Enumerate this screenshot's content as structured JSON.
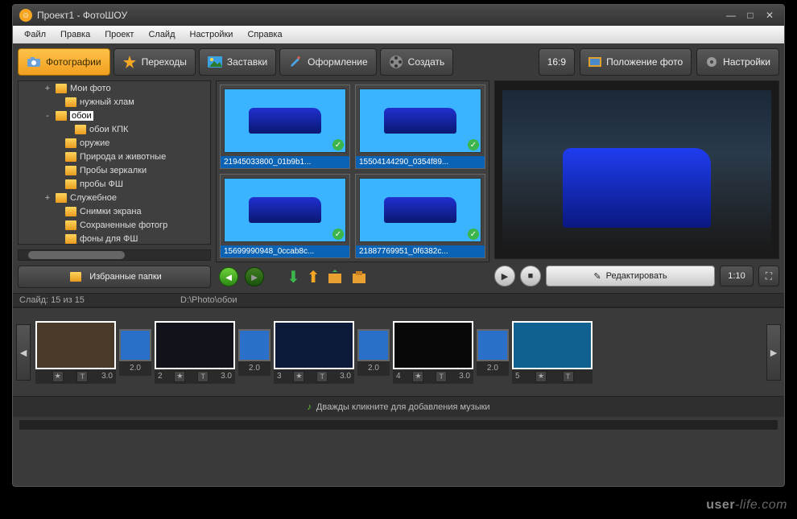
{
  "app": {
    "title": "Проект1 - ФотоШОУ"
  },
  "menu": [
    "Файл",
    "Правка",
    "Проект",
    "Слайд",
    "Настройки",
    "Справка"
  ],
  "tabs": [
    {
      "label": "Фотографии",
      "active": true
    },
    {
      "label": "Переходы"
    },
    {
      "label": "Заставки"
    },
    {
      "label": "Оформление"
    },
    {
      "label": "Создать"
    }
  ],
  "aspect_label": "16:9",
  "right_buttons": [
    {
      "label": "Положение фото"
    },
    {
      "label": "Настройки"
    }
  ],
  "tree": [
    {
      "pm": "+",
      "label": "Мои фото",
      "indent": 2
    },
    {
      "pm": "",
      "label": "нужный хлам",
      "indent": 3
    },
    {
      "pm": "-",
      "label": "обои",
      "indent": 2,
      "selected": true
    },
    {
      "pm": "",
      "label": "обои КПК",
      "indent": 4
    },
    {
      "pm": "",
      "label": "оружие",
      "indent": 3
    },
    {
      "pm": "",
      "label": "Природа и животные",
      "indent": 3
    },
    {
      "pm": "",
      "label": "Пробы зеркалки",
      "indent": 3
    },
    {
      "pm": "",
      "label": "пробы ФШ",
      "indent": 3
    },
    {
      "pm": "+",
      "label": "Служебное",
      "indent": 2
    },
    {
      "pm": "",
      "label": "Снимки экрана",
      "indent": 3
    },
    {
      "pm": "",
      "label": "Сохраненные фотогр",
      "indent": 3
    },
    {
      "pm": "",
      "label": "фоны для ФШ",
      "indent": 3
    }
  ],
  "fav_btn": "Избранные папки",
  "thumbs": [
    {
      "name": "21945033800_01b9b1..."
    },
    {
      "name": "15504144290_0354f89..."
    },
    {
      "name": "15699990948_0ccab8c..."
    },
    {
      "name": "21887769951_0f6382c..."
    }
  ],
  "edit_btn": "Редактировать",
  "time_label": "1:10",
  "slide_info": "Слайд: 15 из 15",
  "path": "D:\\Photo\\обои",
  "slides": [
    {
      "type": "big",
      "num": "",
      "dur": "3.0",
      "bg": "#4a3a2a"
    },
    {
      "type": "trans",
      "dur": "2.0"
    },
    {
      "type": "big",
      "num": "2",
      "dur": "3.0",
      "bg": "#10141a"
    },
    {
      "type": "trans",
      "dur": "2.0"
    },
    {
      "type": "big",
      "num": "3",
      "dur": "3.0",
      "bg": "#0c1a3a"
    },
    {
      "type": "trans",
      "dur": "2.0"
    },
    {
      "type": "big",
      "num": "4",
      "dur": "3.0",
      "bg": "#080808"
    },
    {
      "type": "trans",
      "dur": "2.0"
    },
    {
      "type": "big",
      "num": "5",
      "dur": "",
      "bg": "#106090"
    }
  ],
  "audio_hint": "Дважды кликните для добавления музыки",
  "watermark": "user-life.com"
}
